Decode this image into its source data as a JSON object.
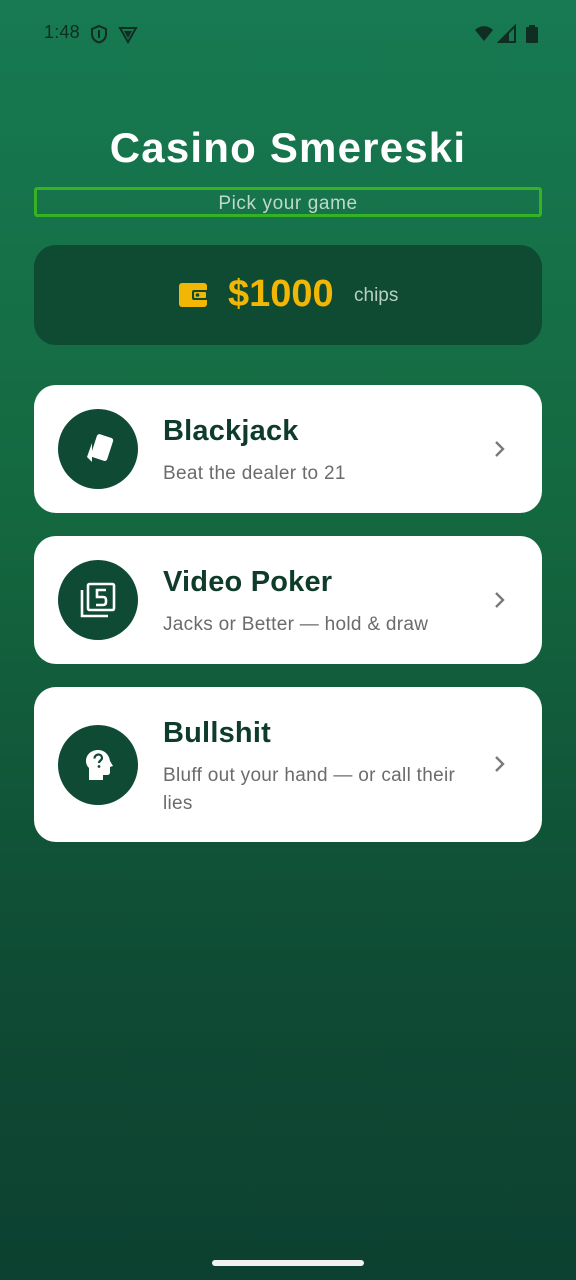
{
  "status_bar": {
    "time": "1:48",
    "icons_left": [
      "shield-icon",
      "vpn-icon"
    ],
    "icons_right": [
      "wifi-icon",
      "signal-icon",
      "battery-icon"
    ]
  },
  "header": {
    "title": "Casino Smereski",
    "subtitle": "Pick your game"
  },
  "chips": {
    "icon": "wallet-icon",
    "amount": "$1000",
    "unit": "chips"
  },
  "games": [
    {
      "title": "Blackjack",
      "description": "Beat the dealer to 21",
      "icon": "playing-cards-icon"
    },
    {
      "title": "Video Poker",
      "description": "Jacks or Better — hold & draw",
      "icon": "filter-5-icon"
    },
    {
      "title": "Bullshit",
      "description": "Bluff out your hand — or call their lies",
      "icon": "head-question-icon"
    }
  ],
  "colors": {
    "background_top": "#177a52",
    "background_bottom": "#0c4030",
    "chips_card": "#0f4a32",
    "chips_amount": "#f2b705",
    "icon_circle": "#0e4a34",
    "card_title": "#0f3b2a",
    "focus_outline": "#35b322"
  }
}
